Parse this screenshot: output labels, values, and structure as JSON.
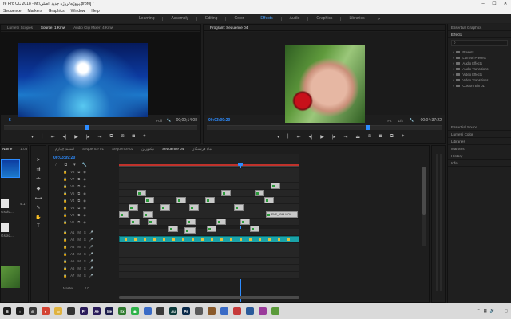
{
  "window": {
    "title": "re Pro CC 2018 - M:\\پروژه\\پروژه جدید \\اصلی.prproj *",
    "controls": [
      "–",
      "☐",
      "✕"
    ]
  },
  "menu": [
    "Sequence",
    "Markers",
    "Graphics",
    "Window",
    "Help"
  ],
  "workspaces": {
    "items": [
      "Learning",
      "Assembly",
      "Editing",
      "Color",
      "Effects",
      "Audio",
      "Graphics",
      "Libraries"
    ],
    "active": "Effects",
    "more": "»"
  },
  "source_monitor": {
    "tabs": [
      "Lumetri Scopes",
      "Source: 1.Ǩmw",
      "Audio Clip Mixer: 4.Ǩmw"
    ],
    "active_tab": 1,
    "timecode_left": "5",
    "fit": "Full",
    "timecode_right": "00;00;14;08"
  },
  "program_monitor": {
    "title": "Program: Sequence 04",
    "timecode_left": "00:03:09:20",
    "fit": "Fit",
    "scale": "1/4",
    "timecode_right": "00:04:37:22"
  },
  "right_column": {
    "essential_graphics": "Essential Graphics",
    "effects_title": "Effects",
    "search_placeholder": "",
    "effects": [
      "Presets",
      "Lumetri Presets",
      "Audio Effects",
      "Audio Transitions",
      "Video Effects",
      "Video Transitions",
      "Custom Bin 01"
    ],
    "panels": [
      "Essential Sound",
      "Lumetri Color",
      "Libraries",
      "Markers",
      "History",
      "Info"
    ]
  },
  "project": {
    "items": [
      {
        "label": "Name",
        "size": "1:03",
        "kind": "ruler"
      },
      {
        "label": "",
        "size": "",
        "kind": "video"
      },
      {
        "label": "",
        "size": "",
        "kind": "blank"
      },
      {
        "label": "Gsold...",
        "size": "4:17",
        "kind": "audio"
      },
      {
        "label": "Gsold...",
        "size": "",
        "kind": "audio"
      },
      {
        "label": "...",
        "size": "",
        "kind": "green"
      }
    ]
  },
  "timeline": {
    "tabs": [
      "اسفند چهارم",
      "Sequence 01",
      "Sequence 02",
      "تیکتورین",
      "Sequence 04",
      "ماه فرشتگان"
    ],
    "active_tab": 4,
    "timecode": "00:03:09:20",
    "tracks_video": [
      "V8",
      "V7",
      "V6",
      "V5",
      "V4",
      "V3",
      "V2",
      "V1"
    ],
    "tracks_audio": [
      "A1",
      "A2",
      "A3",
      "A4",
      "A5",
      "A6",
      "A7"
    ],
    "master_label": "Master",
    "master_value": "0.0",
    "clip_label": "ENS_0044.MOV"
  },
  "taskbar": {
    "apps": [
      {
        "name": "windows-icon",
        "label": "⊞",
        "color": "#1e1e1e"
      },
      {
        "name": "search-icon",
        "label": "○",
        "color": "#1e1e1e"
      },
      {
        "name": "cortana-icon",
        "label": "◎",
        "color": "#3a3a3a"
      },
      {
        "name": "chrome-icon",
        "label": "●",
        "color": "#d44333"
      },
      {
        "name": "file-explorer-icon",
        "label": "▭",
        "color": "#e0b33f"
      },
      {
        "name": "app-icon-1",
        "label": "",
        "color": "#333"
      },
      {
        "name": "premiere-icon",
        "label": "Pr",
        "color": "#2a1b5a"
      },
      {
        "name": "after-effects-icon",
        "label": "Ae",
        "color": "#2a1b5a"
      },
      {
        "name": "media-encoder-icon",
        "label": "Me",
        "color": "#1b1b4a"
      },
      {
        "name": "app-icon-2",
        "label": "Ex",
        "color": "#2f7a2f"
      },
      {
        "name": "whatsapp-icon",
        "label": "◉",
        "color": "#2fb34a"
      },
      {
        "name": "app-icon-3",
        "label": "",
        "color": "#3a6bc6"
      },
      {
        "name": "app-icon-4",
        "label": "",
        "color": "#3a3a3a"
      },
      {
        "name": "audition-icon",
        "label": "Au",
        "color": "#0b3a3a"
      },
      {
        "name": "photoshop-icon",
        "label": "Ps",
        "color": "#0a2a4a"
      },
      {
        "name": "app-icon-5",
        "label": "",
        "color": "#5a5a5a"
      },
      {
        "name": "app-icon-6",
        "label": "",
        "color": "#8a5a2a"
      },
      {
        "name": "app-icon-7",
        "label": "",
        "color": "#3a6bc6"
      },
      {
        "name": "app-icon-8",
        "label": "",
        "color": "#c63a3a"
      },
      {
        "name": "app-icon-9",
        "label": "",
        "color": "#2a5a9a"
      },
      {
        "name": "app-icon-10",
        "label": "",
        "color": "#9a3a9a"
      },
      {
        "name": "app-icon-11",
        "label": "",
        "color": "#5a9a3a"
      }
    ],
    "tray_time": "",
    "tray_lang": ""
  },
  "colors": {
    "accent": "#2d8cff",
    "audio_clip": "#1aa3a8",
    "video_clip": "#c9c9c9",
    "playhead": "#2d8cff"
  }
}
